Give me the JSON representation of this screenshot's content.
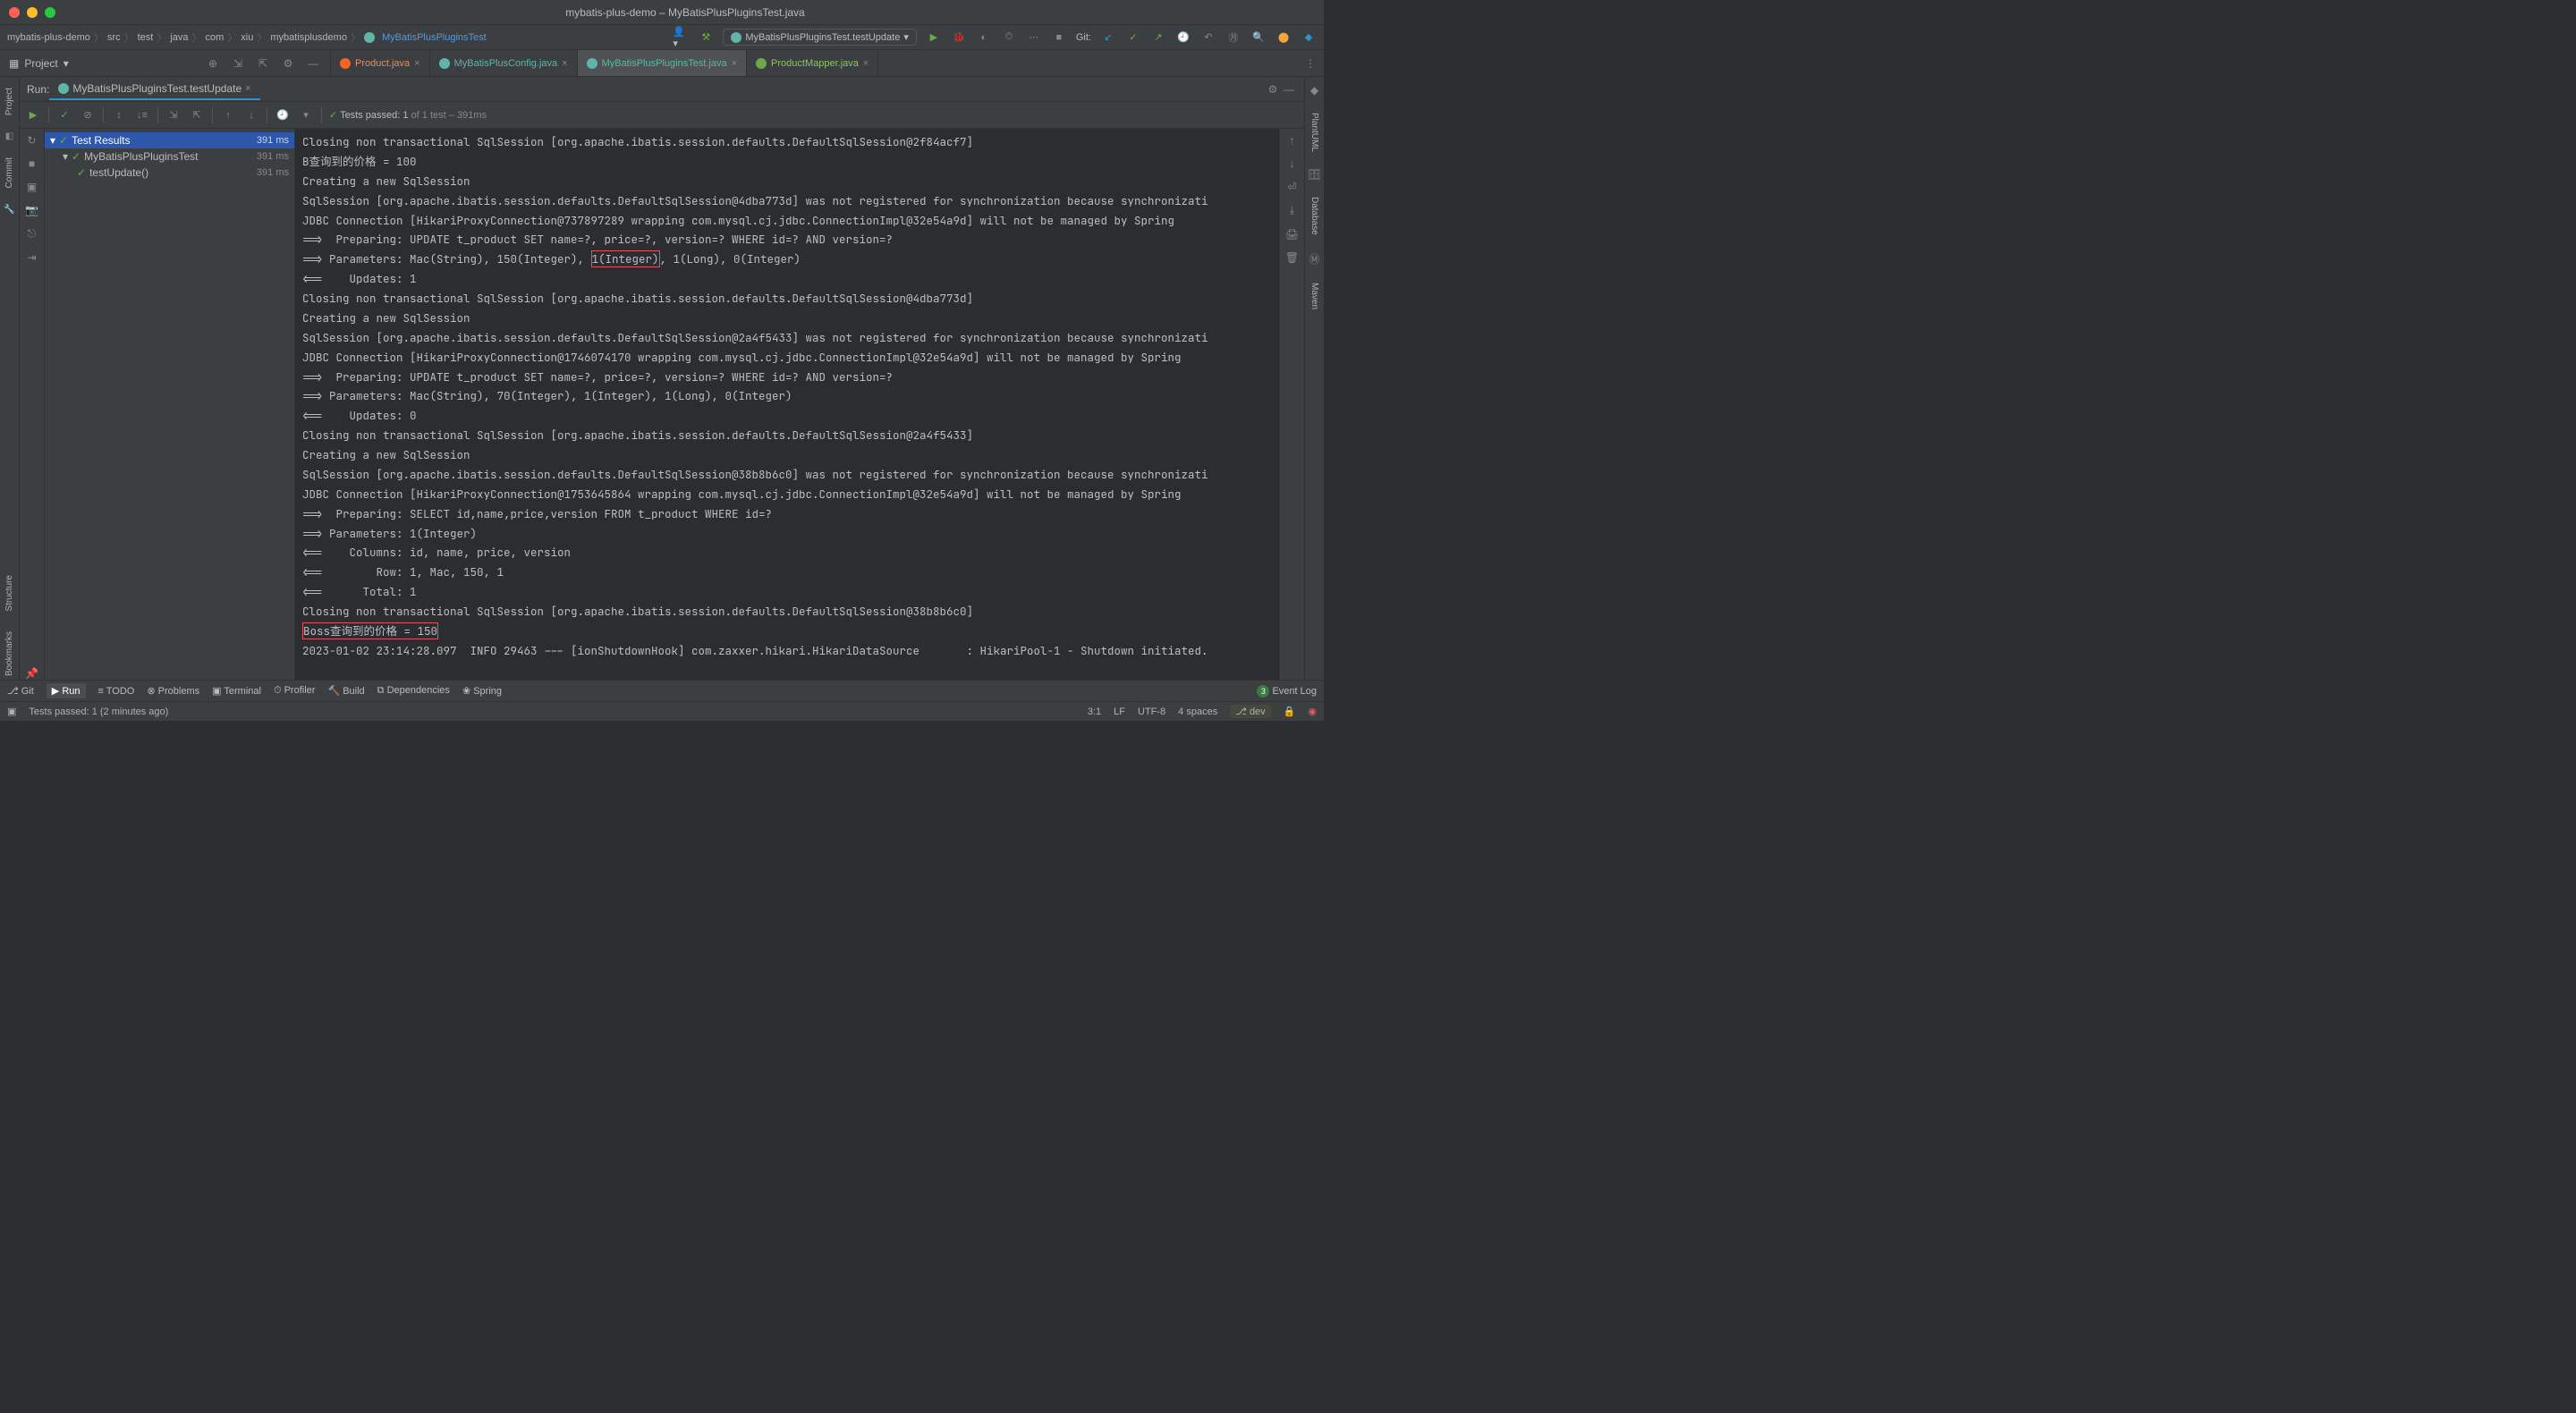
{
  "title": "mybatis-plus-demo – MyBatisPlusPluginsTest.java",
  "breadcrumb": [
    "mybatis-plus-demo",
    "src",
    "test",
    "java",
    "com",
    "xiu",
    "mybatisplusdemo",
    "MyBatisPlusPluginsTest"
  ],
  "run_config": "MyBatisPlusPluginsTest.testUpdate",
  "git_label": "Git:",
  "project_label": "Project",
  "editor_tabs": [
    {
      "label": "Product.java",
      "icon": "orange"
    },
    {
      "label": "MyBatisPlusConfig.java",
      "icon": "cyan"
    },
    {
      "label": "MyBatisPlusPluginsTest.java",
      "icon": "cyan",
      "active": true
    },
    {
      "label": "ProductMapper.java",
      "icon": "green"
    }
  ],
  "run_label": "Run:",
  "run_tab": "MyBatisPlusPluginsTest.testUpdate",
  "test_summary": {
    "prefix": "Tests passed: ",
    "passed": "1",
    "middle": " of 1 test",
    "duration": " – 391ms"
  },
  "test_tree": {
    "root": {
      "label": "Test Results",
      "time": "391 ms"
    },
    "class": {
      "label": "MyBatisPlusPluginsTest",
      "time": "391 ms"
    },
    "method": {
      "label": "testUpdate()",
      "time": "391 ms"
    }
  },
  "console_lines": [
    "Closing non transactional SqlSession [org.apache.ibatis.session.defaults.DefaultSqlSession@2f84acf7]",
    "B查询到的价格 = 100",
    "Creating a new SqlSession",
    "SqlSession [org.apache.ibatis.session.defaults.DefaultSqlSession@4dba773d] was not registered for synchronization because synchronizati",
    "JDBC Connection [HikariProxyConnection@737897289 wrapping com.mysql.cj.jdbc.ConnectionImpl@32e54a9d] will not be managed by Spring",
    "==>  Preparing: UPDATE t_product SET name=?, price=?, version=? WHERE id=? AND version=?",
    {
      "pre": "==> Parameters: Mac(String), 150(Integer), ",
      "hl": "1(Integer)",
      "post": ", 1(Long), 0(Integer)"
    },
    "<==    Updates: 1",
    "Closing non transactional SqlSession [org.apache.ibatis.session.defaults.DefaultSqlSession@4dba773d]",
    "Creating a new SqlSession",
    "SqlSession [org.apache.ibatis.session.defaults.DefaultSqlSession@2a4f5433] was not registered for synchronization because synchronizati",
    "JDBC Connection [HikariProxyConnection@1746074170 wrapping com.mysql.cj.jdbc.ConnectionImpl@32e54a9d] will not be managed by Spring",
    "==>  Preparing: UPDATE t_product SET name=?, price=?, version=? WHERE id=? AND version=?",
    "==> Parameters: Mac(String), 70(Integer), 1(Integer), 1(Long), 0(Integer)",
    "<==    Updates: 0",
    "Closing non transactional SqlSession [org.apache.ibatis.session.defaults.DefaultSqlSession@2a4f5433]",
    "Creating a new SqlSession",
    "SqlSession [org.apache.ibatis.session.defaults.DefaultSqlSession@38b8b6c0] was not registered for synchronization because synchronizati",
    "JDBC Connection [HikariProxyConnection@1753645864 wrapping com.mysql.cj.jdbc.ConnectionImpl@32e54a9d] will not be managed by Spring",
    "==>  Preparing: SELECT id,name,price,version FROM t_product WHERE id=?",
    "==> Parameters: 1(Integer)",
    "<==    Columns: id, name, price, version",
    "<==        Row: 1, Mac, 150, 1",
    "<==      Total: 1",
    "Closing non transactional SqlSession [org.apache.ibatis.session.defaults.DefaultSqlSession@38b8b6c0]",
    {
      "hl": "Boss查询到的价格 = 150"
    },
    "2023-01-02 23:14:28.097  INFO 29463 --- [ionShutdownHook] com.zaxxer.hikari.HikariDataSource       : HikariPool-1 - Shutdown initiated."
  ],
  "left_rail": [
    "Project",
    "Commit",
    "Structure",
    "Bookmarks"
  ],
  "right_rail": [
    "PlantUML",
    "Database",
    "Maven"
  ],
  "bottom_tabs": {
    "git": "Git",
    "run": "Run",
    "todo": "TODO",
    "problems": "Problems",
    "terminal": "Terminal",
    "profiler": "Profiler",
    "build": "Build",
    "dependencies": "Dependencies",
    "spring": "Spring",
    "event_log": "Event Log"
  },
  "status": {
    "message": "Tests passed: 1 (2 minutes ago)",
    "pos": "3:1",
    "lf": "LF",
    "encoding": "UTF-8",
    "spaces": "4 spaces",
    "branch": "dev"
  }
}
